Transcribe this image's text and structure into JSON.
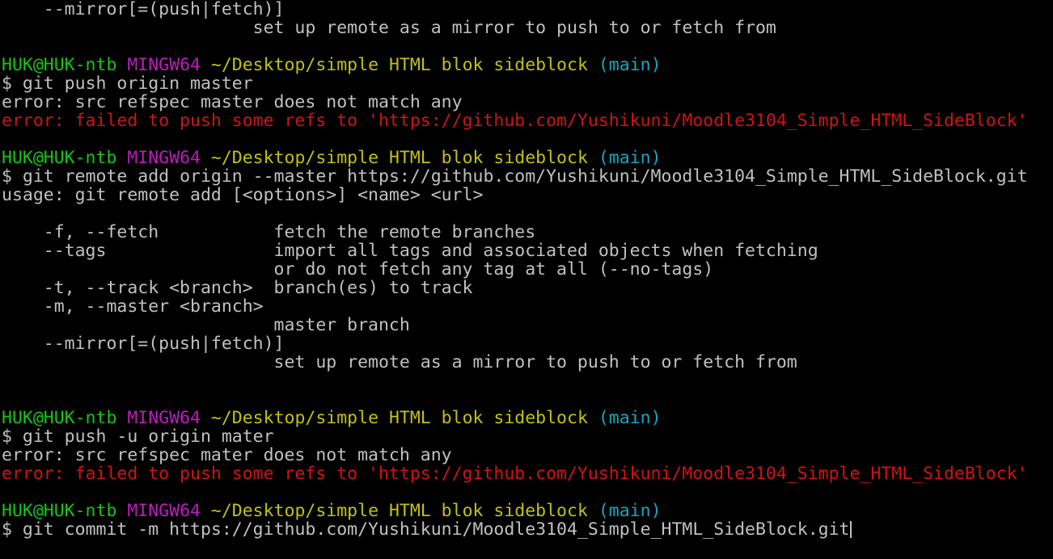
{
  "colors": {
    "background": "#000000",
    "text": "#c0c0c0",
    "user_host": "#13c613",
    "system": "#c119c1",
    "path": "#c1c113",
    "branch": "#13a8c1",
    "error": "#d11313"
  },
  "prompt": {
    "user_host": "HUK@HUK-ntb",
    "system": "MINGW64",
    "path": "~/Desktop/simple HTML blok sideblock",
    "branch": "(main)",
    "symbol": "$"
  },
  "lines": [
    "    --mirror[=(push|fetch)]",
    "                        set up remote as a mirror to push to or fetch from",
    "",
    "",
    "git push origin master",
    "error: src refspec master does not match any",
    "error: failed to push some refs to 'https://github.com/Yushikuni/Moodle3104_Simple_HTML_SideBlock'",
    "",
    "git remote add origin --master https://github.com/Yushikuni/Moodle3104_Simple_HTML_SideBlock.git",
    "usage: git remote add [<options>] <name> <url>",
    "",
    "    -f, --fetch           fetch the remote branches",
    "    --tags                import all tags and associated objects when fetching",
    "                          or do not fetch any tag at all (--no-tags)",
    "    -t, --track <branch>  branch(es) to track",
    "    -m, --master <branch>",
    "                          master branch",
    "    --mirror[=(push|fetch)]",
    "                          set up remote as a mirror to push to or fetch from",
    "",
    "",
    "git push -u origin mater",
    "error: src refspec mater does not match any",
    "error: failed to push some refs to 'https://github.com/Yushikuni/Moodle3104_Simple_HTML_SideBlock'",
    "",
    "git commit -m https://github.com/Yushikuni/Moodle3104_Simple_HTML_SideBlock.git"
  ]
}
